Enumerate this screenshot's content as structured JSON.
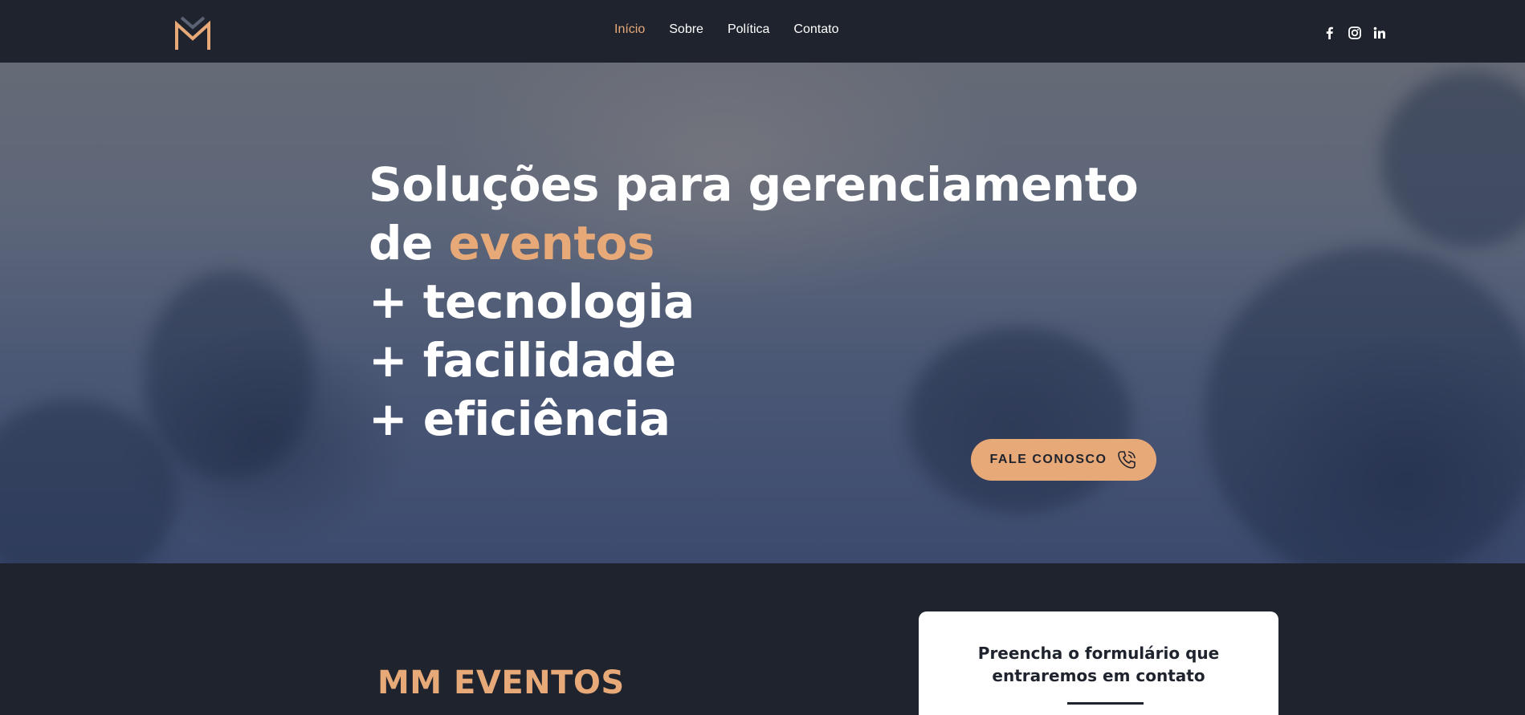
{
  "nav": {
    "items": [
      {
        "label": "Início",
        "active": true
      },
      {
        "label": "Sobre",
        "active": false
      },
      {
        "label": "Política",
        "active": false
      },
      {
        "label": "Contato",
        "active": false
      }
    ]
  },
  "social": [
    "facebook-icon",
    "instagram-icon",
    "linkedin-icon"
  ],
  "hero": {
    "line1": "Soluções para gerenciamento",
    "line2_prefix": "de ",
    "line2_accent": "eventos",
    "line3": "+ tecnologia",
    "line4": "+ facilidade",
    "line5": "+ eficiência",
    "cta_label": "FALE CONOSCO"
  },
  "section": {
    "brand": "MM EVENTOS",
    "form_title_1": "Preencha o formulário que",
    "form_title_2": "entraremos em contato"
  },
  "colors": {
    "background": "#1f232d",
    "accent": "#e8a978",
    "white": "#ffffff"
  }
}
